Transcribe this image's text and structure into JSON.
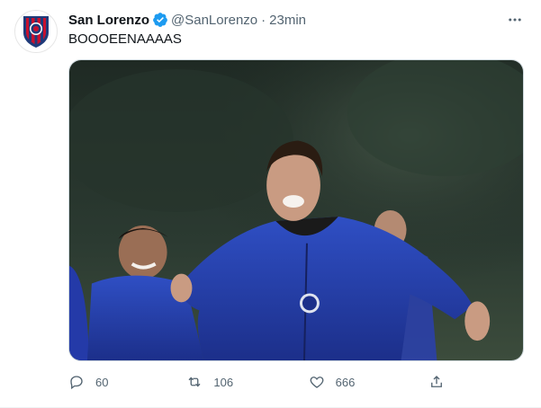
{
  "tweet": {
    "display_name": "San Lorenzo",
    "handle": "@SanLorenzo",
    "separator": "·",
    "time": "23min",
    "text": "BOOOEENAAAAS",
    "verified": true,
    "avatar_icon": "san-lorenzo-crest",
    "more_icon": "more-dots-icon",
    "media_alt": "Jugador de San Lorenzo celebrando con campera azul",
    "stats": {
      "replies": "60",
      "retweets": "106",
      "likes": "666"
    },
    "icons": {
      "reply": "reply-icon",
      "retweet": "retweet-icon",
      "like": "heart-icon",
      "share": "share-icon"
    }
  },
  "colors": {
    "text_primary": "#0f1419",
    "text_secondary": "#536471",
    "verified_blue": "#1d9bf0",
    "crest_blue": "#1f3b7a",
    "crest_red": "#c8102e"
  }
}
